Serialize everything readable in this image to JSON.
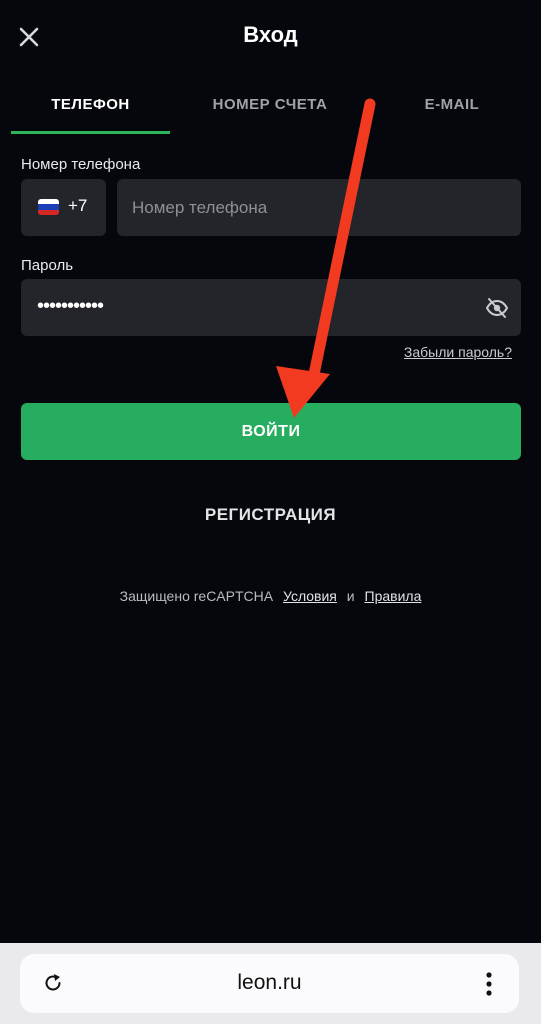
{
  "header": {
    "title": "Вход",
    "close_icon": "close-icon"
  },
  "tabs": [
    {
      "label": "ТЕЛЕФОН",
      "active": true
    },
    {
      "label": "НОМЕР СЧЕТА",
      "active": false
    },
    {
      "label": "E-MAIL",
      "active": false
    }
  ],
  "form": {
    "phone_label": "Номер телефона",
    "country_code": "+7",
    "country_flag": "russia-flag-icon",
    "phone_placeholder": "Номер телефона",
    "phone_value": "",
    "password_label": "Пароль",
    "password_masked": "•••••••••••",
    "eye_icon": "eye-off-icon",
    "forgot_label": "Забыли пароль?"
  },
  "actions": {
    "login_label": "ВОЙТИ",
    "register_label": "РЕГИСТРАЦИЯ"
  },
  "footer": {
    "recaptcha_text": "Защищено reCAPTCHA",
    "terms_label": "Условия",
    "and_text": "и",
    "rules_label": "Правила"
  },
  "browser": {
    "url": "leon.ru",
    "reload_icon": "reload-icon",
    "more_icon": "more-vertical-icon"
  },
  "colors": {
    "background": "#06070c",
    "accent": "#27ad5f",
    "field": "#23252b",
    "arrow": "#f23a20"
  }
}
